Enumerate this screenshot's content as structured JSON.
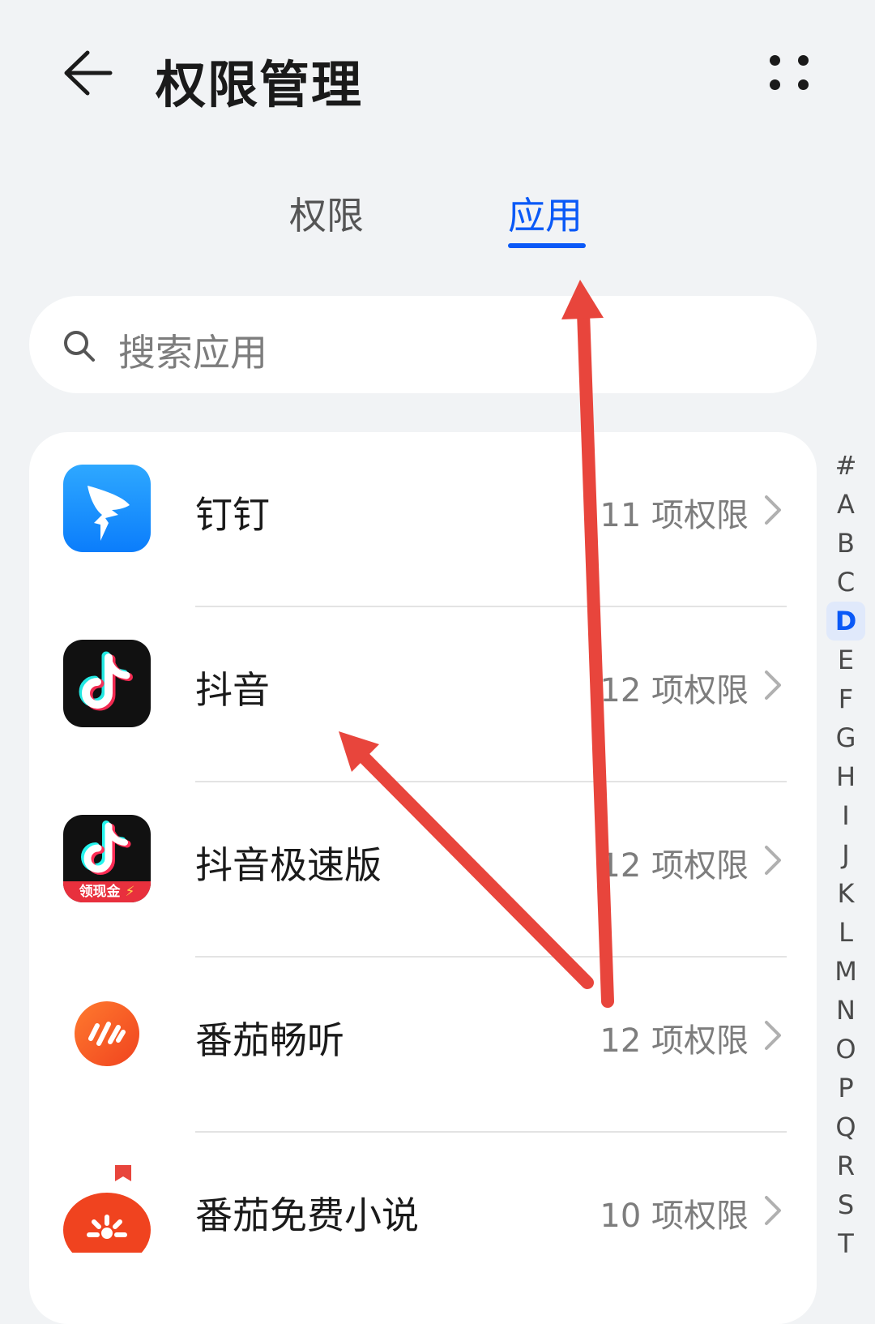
{
  "header": {
    "title": "权限管理"
  },
  "tabs": [
    {
      "label": "权限"
    },
    {
      "label": "应用"
    }
  ],
  "active_tab": "应用",
  "search": {
    "placeholder": "搜索应用"
  },
  "apps": [
    {
      "name": "钉钉",
      "permissions": "11 项权限",
      "icon": "dingtalk-icon"
    },
    {
      "name": "抖音",
      "permissions": "12 项权限",
      "icon": "douyin-icon"
    },
    {
      "name": "抖音极速版",
      "permissions": "12 项权限",
      "icon": "douyin-lite-icon",
      "badge": "领现金"
    },
    {
      "name": "番茄畅听",
      "permissions": "12 项权限",
      "icon": "fanqie-listen-icon"
    },
    {
      "name": "番茄免费小说",
      "permissions": "10 项权限",
      "icon": "fanqie-novel-icon"
    }
  ],
  "alpha_index": [
    "#",
    "A",
    "B",
    "C",
    "D",
    "E",
    "F",
    "G",
    "H",
    "I",
    "J",
    "K",
    "L",
    "M",
    "N",
    "O",
    "P",
    "Q",
    "R",
    "S",
    "T"
  ],
  "alpha_active": "D",
  "colors": {
    "accent": "#0a59f7",
    "annotation_arrow": "#e8453c",
    "background": "#f1f3f5"
  }
}
